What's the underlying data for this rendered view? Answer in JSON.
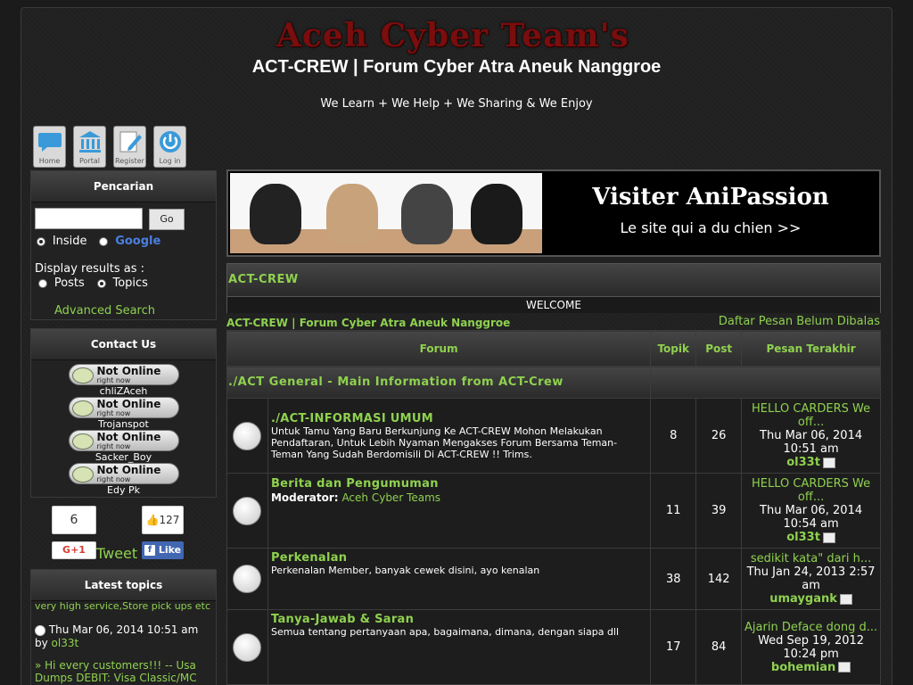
{
  "header": {
    "logo_text": "Aceh Cyber Team's",
    "site_title": "ACT-CREW | Forum Cyber Atra Aneuk Nanggroe",
    "site_desc": "We Learn + We Help + We Sharing & We Enjoy"
  },
  "nav": [
    {
      "label": "Home",
      "icon": "chat-bubble-icon"
    },
    {
      "label": "Portal",
      "icon": "building-icon"
    },
    {
      "label": "Register",
      "icon": "pencil-doc-icon"
    },
    {
      "label": "Log in",
      "icon": "power-icon"
    }
  ],
  "search": {
    "title": "Pencarian",
    "go": "Go",
    "opt_inside": "Inside",
    "opt_google": "Google",
    "display_as": "Display results as :",
    "opt_posts": "Posts",
    "opt_topics": "Topics",
    "advanced": "Advanced Search"
  },
  "contact": {
    "title": "Contact Us",
    "status": "Not Online",
    "status_sub": "right now",
    "users": [
      "chliZAceh",
      "Trojanspot",
      "Sacker_Boy",
      "Edy Pk"
    ]
  },
  "social": {
    "gplus_count": "6",
    "gplus_label": "G+1",
    "tweet": "Tweet",
    "like_count": "127",
    "like_label": "Like"
  },
  "latest": {
    "title": "Latest topics",
    "item1_text": "very high service,Store pick ups etc",
    "item1_date": "Thu Mar 06, 2014 10:51 am",
    "item1_by": "by",
    "item1_author": "ol33t",
    "item2_text": "» Hi every customers!!! -- Usa Dumps DEBIT: Visa Classic/MC"
  },
  "banner": {
    "ad1": "Visiter AniPassion",
    "ad2": "Le site qui a du chien >>"
  },
  "crew": {
    "title": "ACT-CREW",
    "welcome": "WELCOME"
  },
  "breadcrumb": {
    "left": "ACT-CREW | Forum Cyber Atra Aneuk Nanggroe",
    "right": "Daftar Pesan Belum Dibalas"
  },
  "table": {
    "h_forum": "Forum",
    "h_topik": "Topik",
    "h_post": "Post",
    "h_last": "Pesan Terakhir",
    "category": "./ACT General - Main Information from ACT-Crew",
    "rows": [
      {
        "title": "./ACT-INFORMASI UMUM",
        "desc": "Untuk Tamu Yang Baru Berkunjung Ke ACT-CREW Mohon Melakukan Pendaftaran, Untuk Lebih Nyaman Mengakses Forum Bersama Teman-Teman Yang Sudah Berdomisili Di ACT-CREW !! Trims.",
        "mod_label": "",
        "mod": "",
        "topik": "8",
        "post": "26",
        "last_title": "HELLO CARDERS We off...",
        "last_date": "Thu Mar 06, 2014 10:51 am",
        "last_author": "ol33t"
      },
      {
        "title": "Berita dan Pengumuman",
        "desc": "",
        "mod_label": "Moderator:",
        "mod": "Aceh Cyber Teams",
        "topik": "11",
        "post": "39",
        "last_title": "HELLO CARDERS We off...",
        "last_date": "Thu Mar 06, 2014 10:54 am",
        "last_author": "ol33t"
      },
      {
        "title": "Perkenalan",
        "desc": "Perkenalan Member, banyak cewek disini, ayo kenalan",
        "mod_label": "",
        "mod": "",
        "topik": "38",
        "post": "142",
        "last_title": "sedikit kata\" dari h...",
        "last_date": "Thu Jan 24, 2013 2:57 am",
        "last_author": "umaygank"
      },
      {
        "title": "Tanya-Jawab & Saran",
        "desc": "Semua tentang pertanyaan apa, bagaimana, dimana, dengan siapa dll",
        "mod_label": "",
        "mod": "",
        "topik": "17",
        "post": "84",
        "last_title": "Ajarin Deface dong d...",
        "last_date": "Wed Sep 19, 2012 10:24 pm",
        "last_author": "bohemian"
      }
    ]
  },
  "colors": {
    "accent": "#8fd14f",
    "bg": "#1b1b1b",
    "header_grad_top": "#444444",
    "header_grad_bottom": "#2a2a2a"
  }
}
